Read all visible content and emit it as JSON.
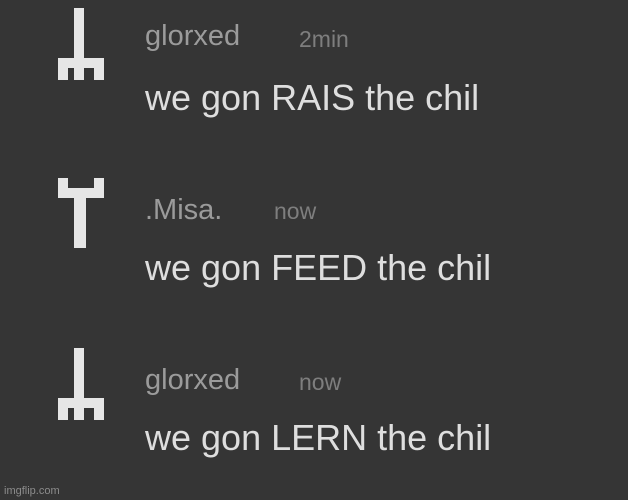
{
  "messages": [
    {
      "username": "glorxed",
      "timestamp": "2min",
      "text": "we gon RAIS the chil",
      "avatar_icon": "dagger-down-icon"
    },
    {
      "username": ".Misa.",
      "timestamp": "now",
      "text": "we gon FEED the chil",
      "avatar_icon": "dagger-up-icon"
    },
    {
      "username": "glorxed",
      "timestamp": "now",
      "text": "we gon LERN the chil",
      "avatar_icon": "dagger-down-icon"
    }
  ],
  "watermark": "imgflip.com",
  "colors": {
    "background": "#353535",
    "username": "#9b9b9b",
    "timestamp": "#7e7e7e",
    "message_text": "#dedede",
    "avatar": "#e6e6e6"
  }
}
